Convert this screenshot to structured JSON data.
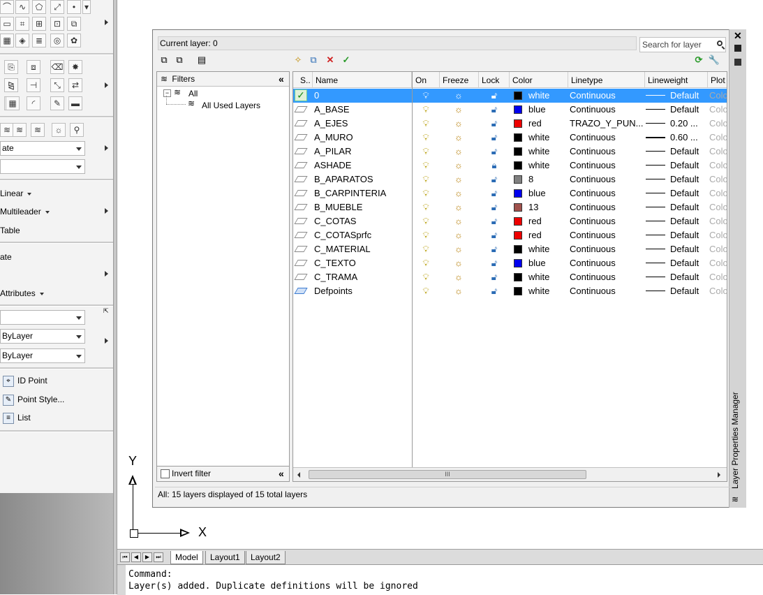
{
  "ribbon": {
    "combo_visual_style": "ate",
    "combo_layer": "",
    "dim_linear": "Linear",
    "dim_multileader": "Multileader",
    "table_label": "Table",
    "block_create": "ate",
    "attributes": "Attributes",
    "props_color": "",
    "props_linetype": "ByLayer",
    "props_lineweight": "ByLayer",
    "utilities": {
      "id_point": "ID Point",
      "point_style": "Point Style...",
      "list": "List"
    }
  },
  "drawing": {
    "ucs_y": "Y",
    "ucs_x": "X"
  },
  "layout_tabs": {
    "model": "Model",
    "layout1": "Layout1",
    "layout2": "Layout2"
  },
  "command_line": {
    "line1": "Command:",
    "line2": "Layer(s) added. Duplicate definitions will be ignored"
  },
  "layer_dialog": {
    "current_layer": "Current layer: 0",
    "search_placeholder": "Search for layer",
    "palette_title": "Layer Properties Manager",
    "filters_header": "Filters",
    "filter_all": "All",
    "filter_all_used": "All Used Layers",
    "invert_filter": "Invert filter",
    "status": "All: 15 layers displayed of 15 total layers",
    "scroll_thumb_grip": "III",
    "columns": [
      "S..",
      "Name",
      "On",
      "Freeze",
      "Lock",
      "Color",
      "Linetype",
      "Lineweight",
      "Plot"
    ],
    "plot_cell_text": "Colo",
    "layers": [
      {
        "name": "0",
        "color_name": "white",
        "color_hex": "#000000",
        "linetype": "Continuous",
        "lineweight": "Default",
        "locked": false,
        "current": true,
        "lw_heavy": false
      },
      {
        "name": "A_BASE",
        "color_name": "blue",
        "color_hex": "#0000ee",
        "linetype": "Continuous",
        "lineweight": "Default",
        "locked": false,
        "current": false,
        "lw_heavy": false
      },
      {
        "name": "A_EJES",
        "color_name": "red",
        "color_hex": "#ee0000",
        "linetype": "TRAZO_Y_PUN...",
        "lineweight": "0.20 ...",
        "locked": false,
        "current": false,
        "lw_heavy": false
      },
      {
        "name": "A_MURO",
        "color_name": "white",
        "color_hex": "#000000",
        "linetype": "Continuous",
        "lineweight": "0.60 ...",
        "locked": false,
        "current": false,
        "lw_heavy": true
      },
      {
        "name": "A_PILAR",
        "color_name": "white",
        "color_hex": "#000000",
        "linetype": "Continuous",
        "lineweight": "Default",
        "locked": false,
        "current": false,
        "lw_heavy": false
      },
      {
        "name": "ASHADE",
        "color_name": "white",
        "color_hex": "#000000",
        "linetype": "Continuous",
        "lineweight": "Default",
        "locked": true,
        "current": false,
        "lw_heavy": false
      },
      {
        "name": "B_APARATOS",
        "color_name": "8",
        "color_hex": "#808080",
        "linetype": "Continuous",
        "lineweight": "Default",
        "locked": false,
        "current": false,
        "lw_heavy": false
      },
      {
        "name": "B_CARPINTERIA",
        "color_name": "blue",
        "color_hex": "#0000ee",
        "linetype": "Continuous",
        "lineweight": "Default",
        "locked": false,
        "current": false,
        "lw_heavy": false
      },
      {
        "name": "B_MUEBLE",
        "color_name": "13",
        "color_hex": "#a0524d",
        "linetype": "Continuous",
        "lineweight": "Default",
        "locked": false,
        "current": false,
        "lw_heavy": false
      },
      {
        "name": "C_COTAS",
        "color_name": "red",
        "color_hex": "#ee0000",
        "linetype": "Continuous",
        "lineweight": "Default",
        "locked": false,
        "current": false,
        "lw_heavy": false
      },
      {
        "name": "C_COTASprfc",
        "color_name": "red",
        "color_hex": "#ee0000",
        "linetype": "Continuous",
        "lineweight": "Default",
        "locked": false,
        "current": false,
        "lw_heavy": false
      },
      {
        "name": "C_MATERIAL",
        "color_name": "white",
        "color_hex": "#000000",
        "linetype": "Continuous",
        "lineweight": "Default",
        "locked": false,
        "current": false,
        "lw_heavy": false
      },
      {
        "name": "C_TEXTO",
        "color_name": "blue",
        "color_hex": "#0000ee",
        "linetype": "Continuous",
        "lineweight": "Default",
        "locked": false,
        "current": false,
        "lw_heavy": false
      },
      {
        "name": "C_TRAMA",
        "color_name": "white",
        "color_hex": "#000000",
        "linetype": "Continuous",
        "lineweight": "Default",
        "locked": false,
        "current": false,
        "lw_heavy": false
      },
      {
        "name": "Defpoints",
        "color_name": "white",
        "color_hex": "#000000",
        "linetype": "Continuous",
        "lineweight": "Default",
        "locked": false,
        "current": false,
        "lw_heavy": false
      }
    ],
    "colors": {
      "selection": "#3399ff",
      "refresh_icon": "#2a9a2a",
      "delete_icon": "#d02020",
      "apply_icon": "#2a9a2a"
    }
  }
}
